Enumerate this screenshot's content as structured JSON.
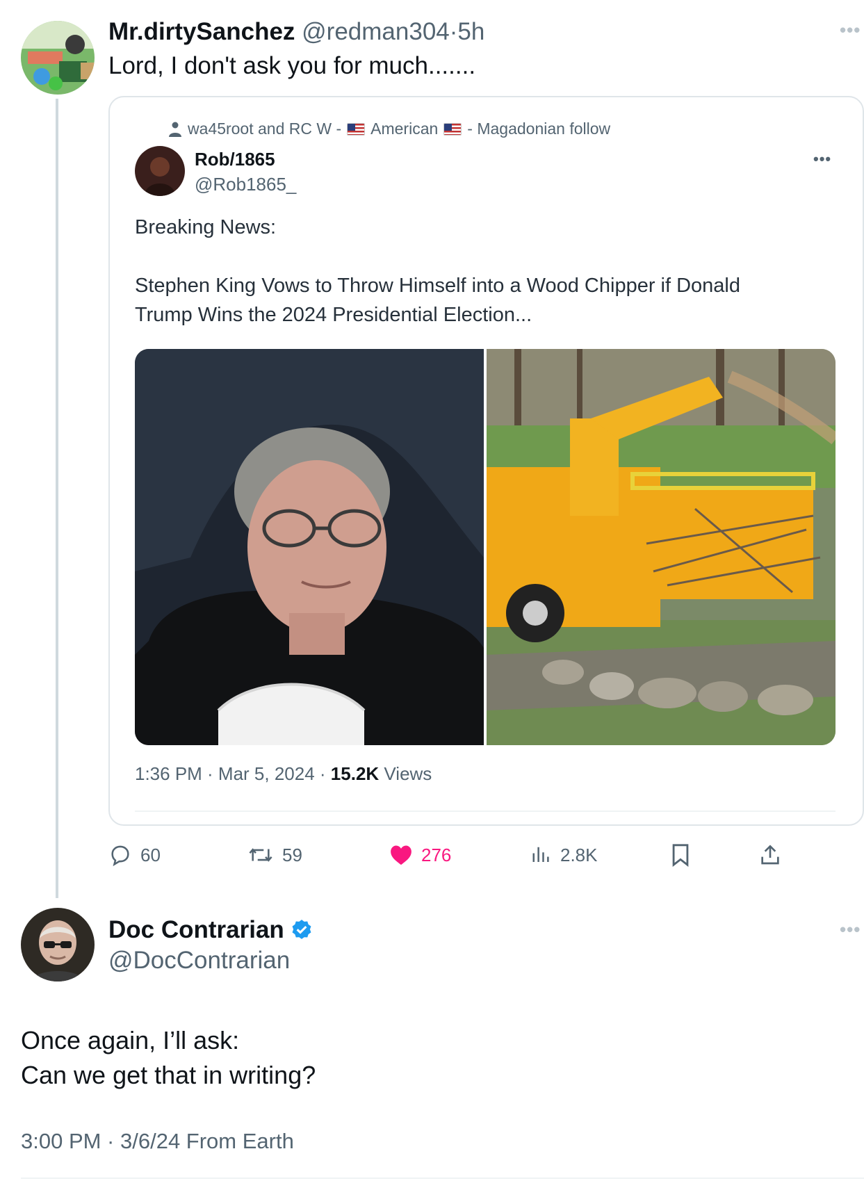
{
  "reply_tweet": {
    "display_name": "Mr.dirtySanchez",
    "handle": "@redman304",
    "separator": "·",
    "relative_time": "5h",
    "text": "Lord, I don't ask you for much.......",
    "avatar_icon": "cartoon-avatar-icon"
  },
  "quoted_tweet": {
    "social_context": {
      "prefix": "wa45root and RC W -",
      "middle": "American",
      "suffix": "- Magadonian follow"
    },
    "display_name": "Rob/1865",
    "handle": "@Rob1865_",
    "text_paragraphs": [
      "Breaking News:",
      "Stephen King Vows to Throw Himself into a Wood Chipper if Donald Trump Wins the 2024 Presidential Election..."
    ],
    "timestamp": "1:36 PM · Mar 5, 2024 ·",
    "views_count": "15.2K",
    "views_label": "Views"
  },
  "actions": {
    "replies": "60",
    "reposts": "59",
    "likes": "276",
    "views": "2.8K"
  },
  "main_tweet": {
    "display_name": "Doc Contrarian",
    "handle": "@DocContrarian",
    "text_lines": [
      "Once again, I’ll ask:",
      "Can we get that in writing?"
    ],
    "meta": "3:00 PM · 3/6/24 From Earth",
    "avatar_icon": "portrait-avatar-icon"
  },
  "colors": {
    "text_primary": "#0f1419",
    "text_secondary": "#536471",
    "like_pink": "#f91880",
    "verified_blue": "#1d9bf0",
    "thread_line": "#cfd9de",
    "chipper_yellow": "#f0a817"
  }
}
